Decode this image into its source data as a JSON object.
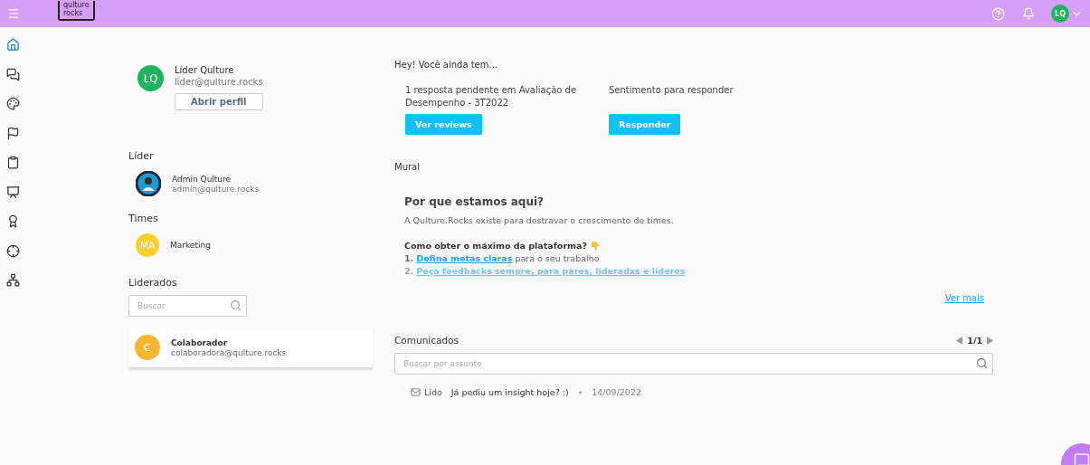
{
  "header": {
    "logo": [
      "qulture",
      "rocks"
    ],
    "avatar": "LQ"
  },
  "nav": [
    {
      "selected": true
    },
    {
      "selected": false
    },
    {
      "selected": false
    },
    {
      "selected": false
    },
    {
      "selected": false
    },
    {
      "selected": false
    },
    {
      "selected": false
    },
    {
      "selected": false
    },
    {
      "selected": false
    }
  ],
  "profile": {
    "initials": "LQ",
    "name": "Líder Qulture",
    "email": "lider@qulture.rocks",
    "button": "Abrir perfil"
  },
  "leader": {
    "title": "Líder",
    "name": "Admin Qulture",
    "email": "admin@qulture.rocks"
  },
  "teams": {
    "title": "Times",
    "items": [
      {
        "initials": "MA",
        "name": "Marketing"
      }
    ]
  },
  "led": {
    "title": "Liderados",
    "search_placeholder": "Buscar",
    "items": [
      {
        "initials": "C",
        "name": "Colaborador",
        "email": "colaboradora@qulture.rocks"
      }
    ]
  },
  "pending": {
    "title": "Hey! Você ainda tem...",
    "items": [
      {
        "text": "1 resposta pendente em Avaliação de Desempenho - 3T2022",
        "button": "Ver reviews"
      },
      {
        "text": "Sentimento para responder",
        "button": "Responder"
      }
    ]
  },
  "mural": {
    "title": "Mural",
    "heading": "Por que estamos aqui?",
    "intro": "A Qulture.Rocks existe para destravar o crescimento de times.",
    "subheading": "Como obter o máximo da plataforma? 👇",
    "steps": [
      {
        "number": "1.",
        "link": "Defina metas claras",
        "rest": " para o seu trabalho"
      },
      {
        "number": "2.",
        "link": "Peça feedbacks sempre, para pares, lideradxs e líderes"
      }
    ],
    "more": "Ver mais"
  },
  "announcements": {
    "title": "Comunicados",
    "page": "1/1",
    "search_placeholder": "Buscar por assunto",
    "items": [
      {
        "status": "Lido",
        "subject": "Já pediu um insight hoje? :)",
        "separator": "•",
        "date": "14/09/2022"
      }
    ]
  }
}
